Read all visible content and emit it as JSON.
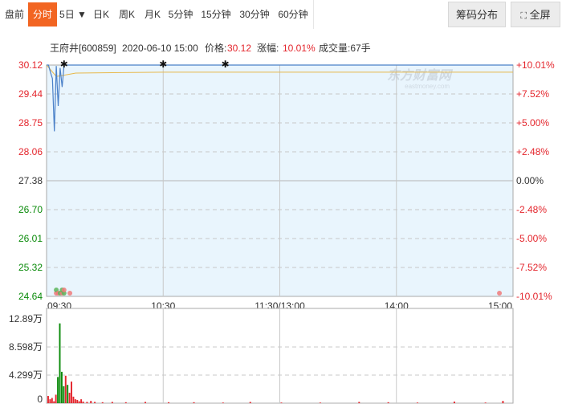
{
  "toolbar": {
    "tabs": [
      {
        "label": "盘前",
        "active": false
      },
      {
        "label": "分时",
        "active": true
      },
      {
        "label": "5日 ▼",
        "active": false
      },
      {
        "label": "日K",
        "active": false
      },
      {
        "label": "周K",
        "active": false
      },
      {
        "label": "月K",
        "active": false
      },
      {
        "label": "5分钟",
        "active": false
      },
      {
        "label": "15分钟",
        "active": false
      },
      {
        "label": "30分钟",
        "active": false
      },
      {
        "label": "60分钟",
        "active": false
      }
    ],
    "chip_label": "筹码分布",
    "fullscreen_label": "全屏"
  },
  "info": {
    "stock": "王府井[600859]",
    "datetime": "2020-06-10 15:00",
    "price_label": "价格:",
    "price": "30.12",
    "change_label": "涨幅:",
    "change": "10.01%",
    "volume": "成交量:67手"
  },
  "watermark": {
    "brand": "东方财富网",
    "url": "eastmoney.com"
  },
  "colors": {
    "up": "#e4262d",
    "down": "#0b8b0b",
    "price_line": "#4a80c8",
    "avg_line": "#e8b84a",
    "plot_bg": "#e9f5fd"
  },
  "chart_data": [
    {
      "type": "line",
      "name": "price",
      "y_ticks": [
        "30.12",
        "29.44",
        "28.75",
        "28.06",
        "27.38",
        "26.70",
        "26.01",
        "25.32",
        "24.64"
      ],
      "y_pct_ticks": [
        "+10.01%",
        "+7.52%",
        "+5.00%",
        "+2.48%",
        "0.00%",
        "-2.48%",
        "-5.00%",
        "-7.52%",
        "-10.01%"
      ],
      "x_ticks": [
        "09:30",
        "10:30",
        "11:30/13:00",
        "14:00",
        "15:00"
      ],
      "ylim": [
        24.64,
        30.12
      ],
      "reference_price": 27.38,
      "x": [
        0,
        1,
        2,
        3,
        4,
        5,
        6,
        7,
        8,
        9,
        10,
        11,
        12,
        240
      ],
      "price": [
        30.12,
        30.12,
        29.95,
        29.8,
        28.55,
        30.1,
        29.15,
        30.05,
        29.6,
        30.12,
        30.12,
        30.12,
        30.12,
        30.12
      ],
      "avg_x": [
        0,
        5,
        9,
        15,
        60,
        120,
        240
      ],
      "avg": [
        30.12,
        29.85,
        29.88,
        29.93,
        29.95,
        29.95,
        29.95
      ],
      "markers_x": [
        9,
        60,
        92
      ],
      "dots": [
        {
          "x": 5,
          "color": "up"
        },
        {
          "x": 5,
          "color": "down"
        },
        {
          "x": 6,
          "color": "up"
        },
        {
          "x": 7,
          "color": "down"
        },
        {
          "x": 8,
          "color": "up"
        },
        {
          "x": 8,
          "color": "down"
        },
        {
          "x": 9,
          "color": "down"
        },
        {
          "x": 9,
          "color": "up"
        },
        {
          "x": 12,
          "color": "up"
        },
        {
          "x": 233,
          "color": "up"
        }
      ]
    },
    {
      "type": "bar",
      "name": "volume",
      "y_ticks": [
        "12.89万",
        "8.598万",
        "4.299万",
        "0"
      ],
      "ylim": [
        0,
        12.89
      ],
      "unit": "万",
      "bars": [
        {
          "x": 0,
          "v": 1.1,
          "c": "up"
        },
        {
          "x": 1,
          "v": 0.6,
          "c": "up"
        },
        {
          "x": 2,
          "v": 0.8,
          "c": "up"
        },
        {
          "x": 3,
          "v": 0.3,
          "c": "up"
        },
        {
          "x": 4,
          "v": 1.3,
          "c": "up"
        },
        {
          "x": 5,
          "v": 4.0,
          "c": "down"
        },
        {
          "x": 6,
          "v": 12.2,
          "c": "down"
        },
        {
          "x": 7,
          "v": 4.8,
          "c": "down"
        },
        {
          "x": 8,
          "v": 2.6,
          "c": "down"
        },
        {
          "x": 9,
          "v": 4.2,
          "c": "up"
        },
        {
          "x": 10,
          "v": 2.8,
          "c": "down"
        },
        {
          "x": 11,
          "v": 1.6,
          "c": "up"
        },
        {
          "x": 12,
          "v": 3.3,
          "c": "up"
        },
        {
          "x": 13,
          "v": 1.0,
          "c": "up"
        },
        {
          "x": 14,
          "v": 0.6,
          "c": "up"
        },
        {
          "x": 15,
          "v": 0.5,
          "c": "up"
        },
        {
          "x": 16,
          "v": 0.3,
          "c": "up"
        },
        {
          "x": 17,
          "v": 0.6,
          "c": "up"
        },
        {
          "x": 18,
          "v": 0.25,
          "c": "up"
        },
        {
          "x": 20,
          "v": 0.2,
          "c": "up"
        },
        {
          "x": 22,
          "v": 0.35,
          "c": "up"
        },
        {
          "x": 24,
          "v": 0.2,
          "c": "up"
        },
        {
          "x": 28,
          "v": 0.15,
          "c": "up"
        },
        {
          "x": 33,
          "v": 0.2,
          "c": "up"
        },
        {
          "x": 40,
          "v": 0.15,
          "c": "up"
        },
        {
          "x": 50,
          "v": 0.2,
          "c": "up"
        },
        {
          "x": 62,
          "v": 0.15,
          "c": "up"
        },
        {
          "x": 75,
          "v": 0.15,
          "c": "up"
        },
        {
          "x": 90,
          "v": 0.1,
          "c": "up"
        },
        {
          "x": 104,
          "v": 0.2,
          "c": "up"
        },
        {
          "x": 120,
          "v": 0.1,
          "c": "up"
        },
        {
          "x": 140,
          "v": 0.1,
          "c": "up"
        },
        {
          "x": 160,
          "v": 0.2,
          "c": "up"
        },
        {
          "x": 175,
          "v": 0.15,
          "c": "up"
        },
        {
          "x": 190,
          "v": 0.1,
          "c": "up"
        },
        {
          "x": 209,
          "v": 0.25,
          "c": "up"
        },
        {
          "x": 225,
          "v": 0.1,
          "c": "up"
        },
        {
          "x": 234,
          "v": 0.35,
          "c": "up"
        }
      ]
    }
  ]
}
